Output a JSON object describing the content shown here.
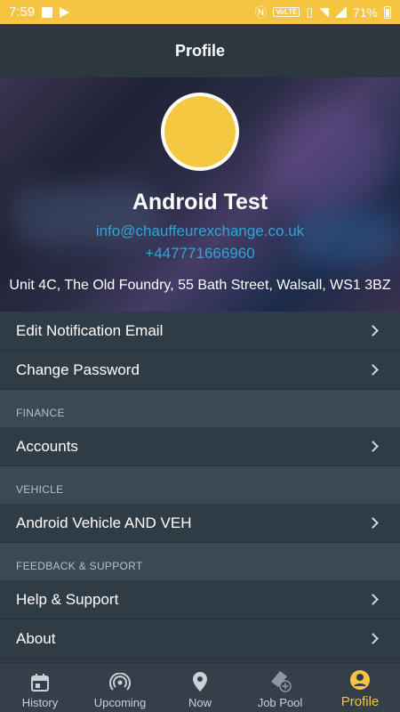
{
  "status": {
    "time": "7:59",
    "volte": "VoLTE",
    "battery": "71%",
    "icons": [
      "stop-icon",
      "play-store-icon",
      "nfc-icon",
      "volte-icon",
      "vibrate-icon",
      "wifi-icon",
      "signal-icon",
      "battery-icon"
    ]
  },
  "header": {
    "title": "Profile"
  },
  "profile": {
    "name": "Android Test",
    "email": "info@chauffeurexchange.co.uk",
    "phone": "+447771666960",
    "address": "Unit 4C, The Old Foundry, 55 Bath Street, Walsall, WS1 3BZ",
    "avatar_color": "#f5c842"
  },
  "menu": {
    "edit_email": "Edit Notification Email",
    "change_password": "Change Password",
    "finance_header": "FINANCE",
    "accounts": "Accounts",
    "vehicle_header": "VEHICLE",
    "vehicle": "Android Vehicle AND VEH",
    "support_header": "FEEDBACK & SUPPORT",
    "help": "Help & Support",
    "about": "About"
  },
  "tabs": {
    "history": "History",
    "upcoming": "Upcoming",
    "now": "Now",
    "job_pool": "Job Pool",
    "profile": "Profile"
  },
  "colors": {
    "accent": "#f5c542",
    "link": "#2aa7d8",
    "background": "#2f3a44"
  }
}
